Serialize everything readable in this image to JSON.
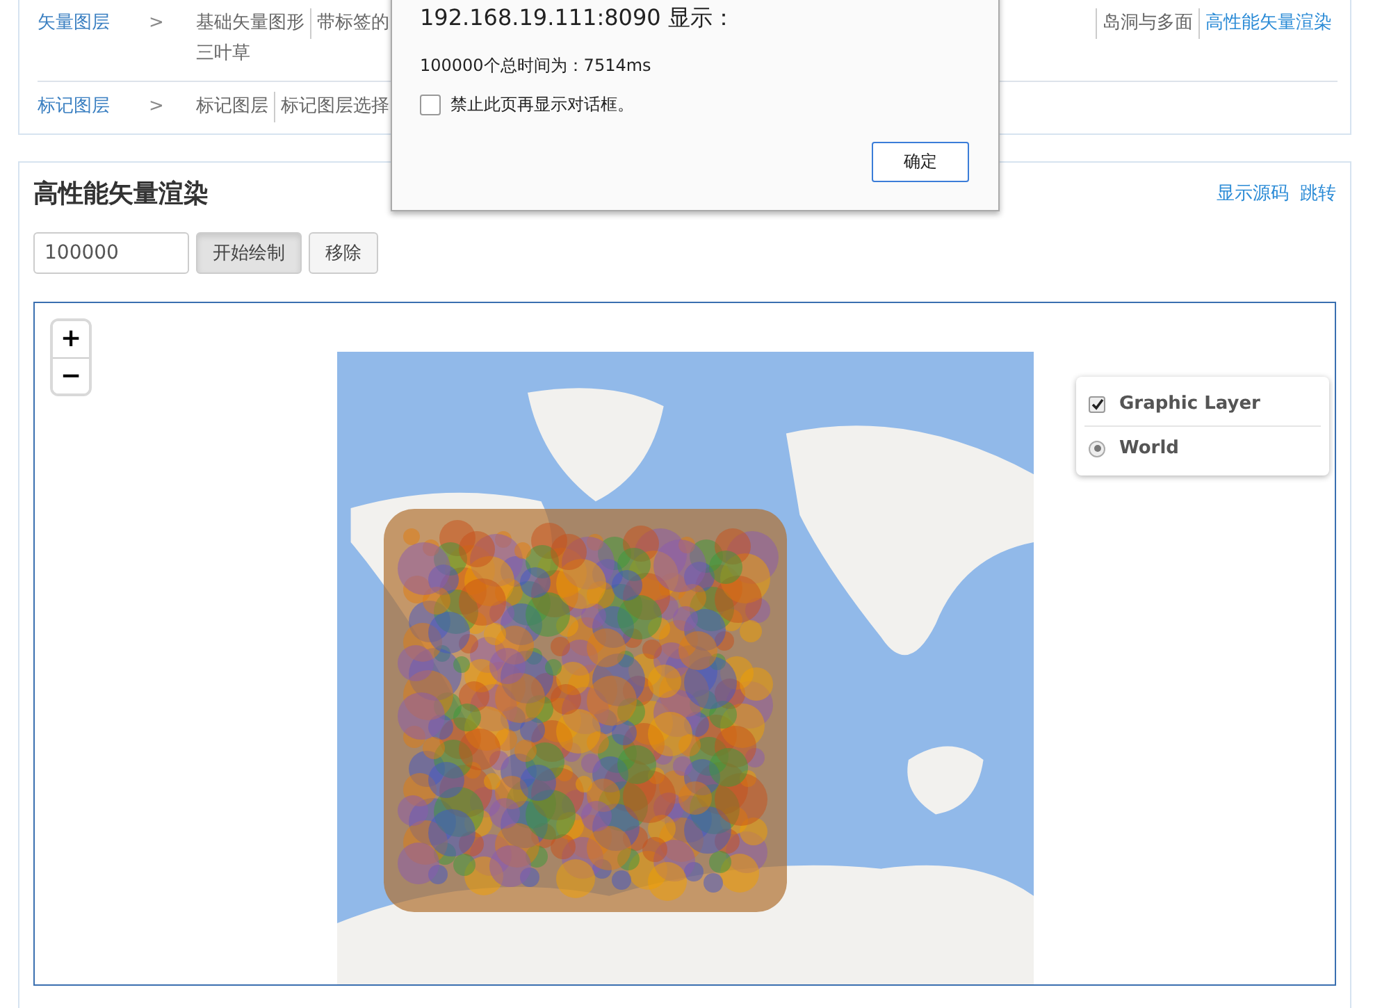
{
  "nav": [
    {
      "category": "矢量图层",
      "items": [
        {
          "label": "基础矢量图形",
          "selected": false
        },
        {
          "label": "带标签的",
          "selected": false
        },
        {
          "label": "岛洞与多面",
          "selected": false
        },
        {
          "label": "高性能矢量渲染",
          "selected": true
        },
        {
          "label": "三叶草",
          "selected": false
        }
      ]
    },
    {
      "category": "标记图层",
      "items": [
        {
          "label": "标记图层",
          "selected": false
        },
        {
          "label": "标记图层选择",
          "selected": false
        }
      ]
    }
  ],
  "separator": ">",
  "panel": {
    "title": "高性能矢量渲染",
    "links": [
      "显示源码",
      "跳转"
    ],
    "count_value": "100000",
    "buttons": [
      {
        "label": "开始绘制",
        "pressed": true
      },
      {
        "label": "移除",
        "pressed": false
      }
    ]
  },
  "map": {
    "zoom_in": "+",
    "zoom_out": "−",
    "layers": [
      {
        "kind": "overlay",
        "label": "Graphic Layer",
        "checked": true
      },
      {
        "kind": "base",
        "label": "World",
        "selected": true
      }
    ]
  },
  "dialog": {
    "title": "192.168.19.111:8090 显示：",
    "message": "100000个总时间为：7514ms",
    "suppress_label": "禁止此页再显示对话框。",
    "suppress_checked": false,
    "ok": "确定"
  }
}
